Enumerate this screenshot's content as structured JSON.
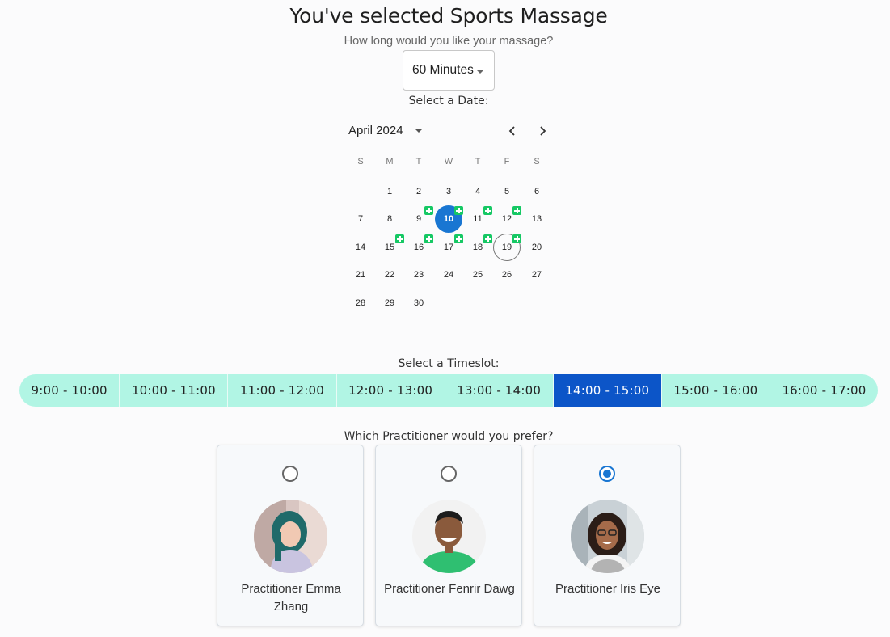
{
  "page": {
    "title": "You've selected Sports Massage",
    "duration_label": "How long would you like your massage?",
    "duration_value": "60 Minutes",
    "date_label": "Select a Date:",
    "timeslot_label": "Select a Timeslot:",
    "practitioner_label": "Which Practitioner would you prefer?"
  },
  "calendar": {
    "month_label": "April 2024",
    "weekdays": [
      "S",
      "M",
      "T",
      "W",
      "T",
      "F",
      "S"
    ],
    "first_weekday_index": 1,
    "days_in_month": 30,
    "selected_day": 10,
    "today_day": 19,
    "available_days": [
      9,
      10,
      11,
      12,
      15,
      16,
      17,
      18,
      19
    ],
    "accent_color": "#1976d2",
    "available_badge_color": "#16c864"
  },
  "timeslots": {
    "items": [
      "9:00 - 10:00",
      "10:00 - 11:00",
      "11:00 - 12:00",
      "12:00 - 13:00",
      "13:00 - 14:00",
      "14:00 - 15:00",
      "15:00 - 16:00",
      "16:00 - 17:00"
    ],
    "selected_index": 5,
    "bar_color": "#b1f5e4",
    "selected_color": "#0c55c8"
  },
  "practitioners": [
    {
      "name": "Practitioner Emma Zhang",
      "selected": false,
      "avatar": "avatar-emma"
    },
    {
      "name": "Practitioner Fenrir Dawg",
      "selected": false,
      "avatar": "avatar-fenrir"
    },
    {
      "name": "Practitioner Iris Eye",
      "selected": true,
      "avatar": "avatar-iris"
    }
  ]
}
